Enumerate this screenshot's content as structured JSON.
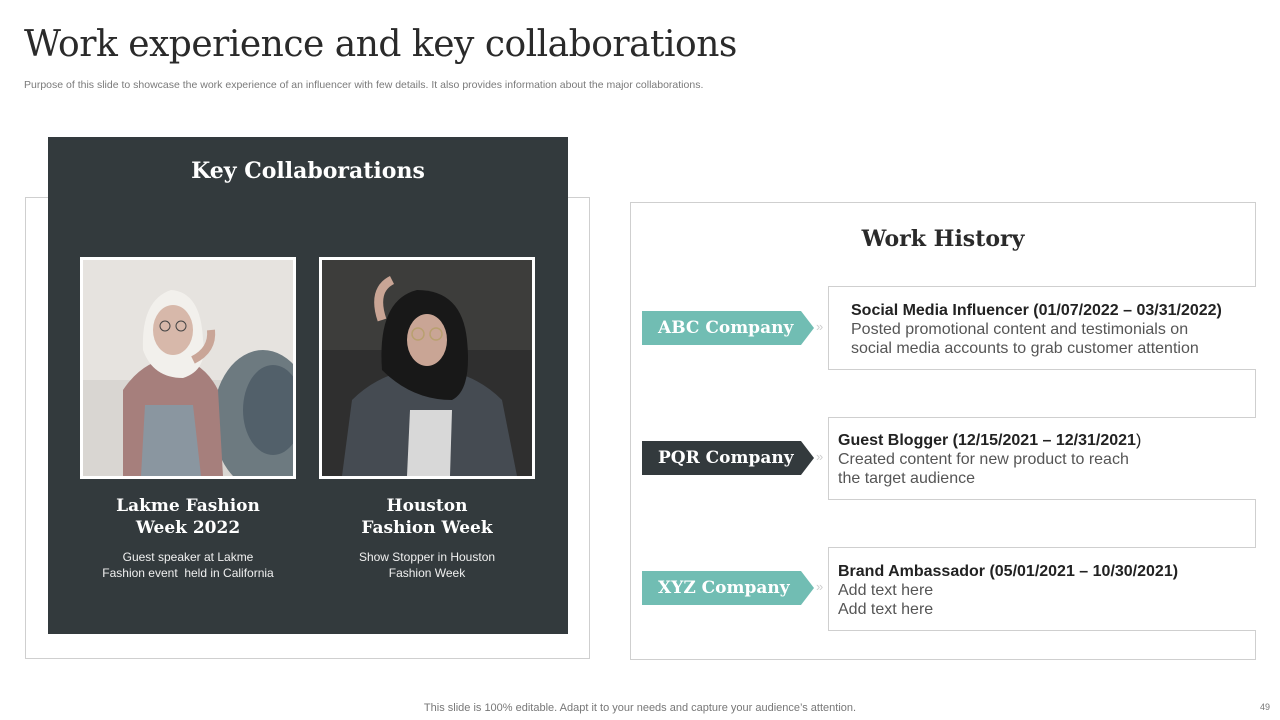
{
  "slide": {
    "title": "Work experience and key collaborations",
    "subtitle": "Purpose of this slide to showcase the work experience of an influencer with few details. It also provides information about the major collaborations.",
    "footer": "This slide is 100% editable. Adapt it to your needs and capture your audience’s attention.",
    "page_number": "49"
  },
  "collaborations": {
    "heading": "Key Collaborations",
    "items": [
      {
        "name_line1": "Lakme Fashion",
        "name_line2": "Week 2022",
        "desc_line1": "Guest speaker at Lakme",
        "desc_line2": "Fashion event  held in California",
        "photo": "woman-in-headscarf-photo"
      },
      {
        "name_line1": "Houston",
        "name_line2": "Fashion Week",
        "desc_line1": "Show Stopper in Houston",
        "desc_line2": "Fashion Week",
        "photo": "woman-in-denim-jacket-photo"
      }
    ]
  },
  "work_history": {
    "heading": "Work History",
    "entries": [
      {
        "company": "ABC Company",
        "title_main": "Social Media Influencer (01/07/2022 – 03/31/2022)",
        "title_suffix": "",
        "line1": "Posted promotional content and testimonials on",
        "line2": "social media accounts to grab customer attention",
        "tag_color": "#71bdb3"
      },
      {
        "company": "PQR Company",
        "title_main": "Guest Blogger (12/15/2021 – 12/31/2021",
        "title_suffix": ")",
        "line1": "Created content for new product to reach",
        "line2": "the target audience",
        "tag_color": "#333a3d"
      },
      {
        "company": "XYZ Company",
        "title_main": "Brand Ambassador (05/01/2021 – 10/30/2021)",
        "title_suffix": "",
        "line1": "Add text here",
        "line2": "Add text here",
        "tag_color": "#71bdb3"
      }
    ],
    "connector": "»"
  }
}
